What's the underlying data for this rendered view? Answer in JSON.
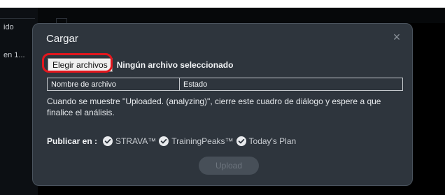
{
  "background": {
    "sidebar_items": [
      "ido",
      "en 1..."
    ]
  },
  "modal": {
    "title": "Cargar",
    "close_glyph": "×",
    "choose_files_label": "Elegir archivos",
    "no_file_text": "Ningún archivo seleccionado",
    "table": {
      "columns": [
        "Nombre de archivo",
        "Estado"
      ]
    },
    "instructions": "Cuando se muestre \"Uploaded. (analyzing)\", cierre este cuadro de diálogo y espere a que finalice el análisis.",
    "publish": {
      "label": "Publicar en :",
      "services": [
        "STRAVA™",
        "TrainingPeaks™",
        "Today's Plan"
      ]
    },
    "upload_label": "Upload"
  },
  "colors": {
    "highlight": "#e2161d",
    "modal_bg": "#2e353d",
    "check": "#e8eaed"
  },
  "icons": {
    "close": "close-icon",
    "check": "check-circle-icon"
  }
}
